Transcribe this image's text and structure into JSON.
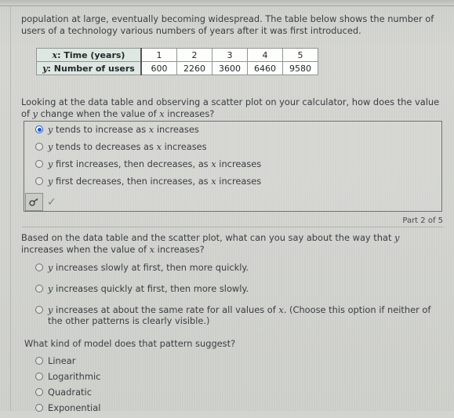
{
  "intro": {
    "text": "population at large, eventually becoming widespread. The table below shows the number of users of a technology various numbers of years after it was first introduced."
  },
  "data_table": {
    "row_headers": [
      "x: Time (years)",
      "y: Number of users"
    ],
    "x_label_prefix": "x",
    "x_label_rest": ": Time (years)",
    "y_label_prefix": "y",
    "y_label_rest": ": Number of users",
    "x_values": [
      "1",
      "2",
      "3",
      "4",
      "5"
    ],
    "y_values": [
      "600",
      "2260",
      "3600",
      "6460",
      "9580"
    ]
  },
  "chart_data": {
    "type": "table",
    "title": "Number of users of a technology various numbers of years after it was first introduced",
    "xlabel": "x: Time (years)",
    "ylabel": "y: Number of users",
    "x": [
      1,
      2,
      3,
      4,
      5
    ],
    "values": [
      600,
      2260,
      3600,
      6460,
      9580
    ],
    "categories": [
      "1",
      "2",
      "3",
      "4",
      "5"
    ],
    "series": [
      {
        "name": "y: Number of users",
        "values": [
          600,
          2260,
          3600,
          6460,
          9580
        ]
      }
    ]
  },
  "question1": {
    "prompt": "Looking at the data table and observing a scatter plot on your calculator, how does the value of y change when the value of x increases?",
    "prompt_part1": "Looking at the data table and observing a scatter plot on your calculator, how does the value of ",
    "prompt_var1": "y",
    "prompt_part2": " change when the value of ",
    "prompt_var2": "x",
    "prompt_part3": " increases?",
    "options": [
      {
        "text": "y tends to increase as x increases",
        "selected": true
      },
      {
        "text": "y tends to decreases as x increases",
        "selected": false
      },
      {
        "text": "y first increases, then decreases, as x increases",
        "selected": false
      },
      {
        "text": "y first decreases, then increases, as x increases",
        "selected": false
      }
    ],
    "tool_icon": "key-icon",
    "status_icon": "checkmark-icon"
  },
  "part_label": "Part 2 of 5",
  "question2": {
    "prompt": "Based on the data table and the scatter plot, what can you say about the way that y increases when the value of x increases?",
    "options": [
      {
        "text": "y increases slowly at first, then more quickly.",
        "selected": false
      },
      {
        "text": "y increases quickly at first, then more slowly.",
        "selected": false
      },
      {
        "text": "y increases at about the same rate for all values of x. (Choose this option if neither of the other patterns is clearly visible.)",
        "selected": false
      }
    ]
  },
  "question3": {
    "prompt": "What kind of model does that pattern suggest?",
    "options": [
      {
        "text": "Linear",
        "selected": false
      },
      {
        "text": "Logarithmic",
        "selected": false
      },
      {
        "text": "Quadratic",
        "selected": false
      },
      {
        "text": "Exponential",
        "selected": false
      }
    ]
  },
  "colors": {
    "page_background": "#d3d4cf",
    "text": "#3a3e41",
    "selected_radio": "#1b58c4",
    "table_header_bg": "#dfe7e2",
    "checkmark": "#6f8a6c"
  }
}
